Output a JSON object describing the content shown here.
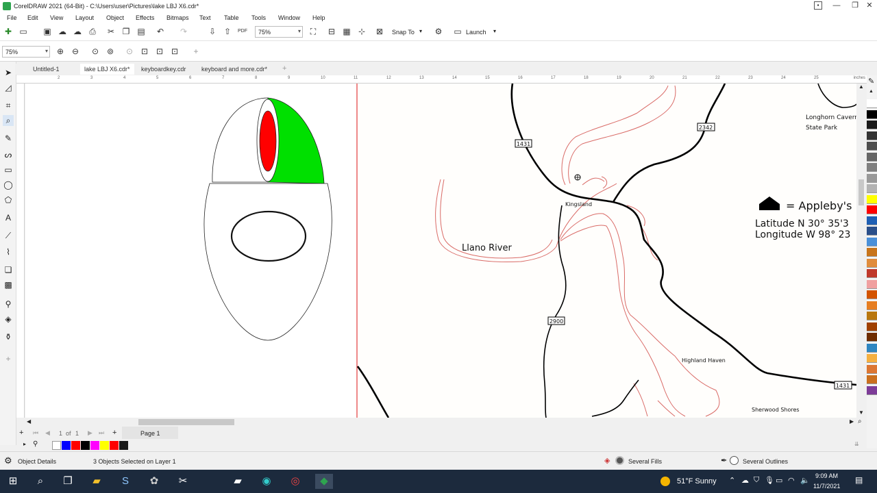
{
  "window": {
    "title": "CorelDRAW 2021 (64-Bit) - C:\\Users\\user\\Pictures\\lake LBJ X6.cdr*",
    "controls": [
      "minimize",
      "maximize",
      "close"
    ]
  },
  "menu": [
    "File",
    "Edit",
    "View",
    "Layout",
    "Object",
    "Effects",
    "Bitmaps",
    "Text",
    "Table",
    "Tools",
    "Window",
    "Help"
  ],
  "standard_toolbar": {
    "zoom_value": "75%",
    "snap_to_label": "Snap To",
    "launch_label": "Launch"
  },
  "property_bar": {
    "zoom_value": "75%"
  },
  "tabs": [
    {
      "label": "Untitled-1",
      "active": false
    },
    {
      "label": "lake LBJ X6.cdr*",
      "active": true
    },
    {
      "label": "keyboardkey.cdr",
      "active": false
    },
    {
      "label": "keyboard and more.cdr*",
      "active": false
    }
  ],
  "ruler": {
    "numbers": [
      "2",
      "3",
      "4",
      "5",
      "6",
      "7",
      "8",
      "9",
      "10",
      "11",
      "12",
      "13",
      "14",
      "15",
      "16",
      "17",
      "18",
      "19",
      "20",
      "21",
      "22",
      "23",
      "24",
      "25"
    ],
    "units": "inches"
  },
  "map": {
    "labels": {
      "river": "Llano River",
      "kingsland": "Kingsland",
      "highland_haven": "Highland Haven",
      "sherwood_shores": "Sherwood Shores",
      "longhorn_line1": "Longhorn Cavern",
      "longhorn_line2": "State Park",
      "applebys": "= Appleby's",
      "latitude": "Latitude N 30° 35'3",
      "longitude": "Longitude W 98° 23"
    },
    "shields": {
      "s1431a": "1431",
      "s2342": "2342",
      "s2900": "2900",
      "s1431b": "1431"
    }
  },
  "page_nav": {
    "current": "1",
    "of_label": "of",
    "total": "1",
    "page_tab": "Page 1"
  },
  "palette_colors": [
    "#0000ff",
    "#ff0000",
    "#000000",
    "#ff00ff",
    "#ffff00",
    "#ff0000",
    "#1a1a1a"
  ],
  "docker_colors": [
    "#ffffff",
    "#000000",
    "#1a1a1a",
    "#333333",
    "#4d4d4d",
    "#666666",
    "#808080",
    "#999999",
    "#b3b3b3",
    "#ffff00",
    "#ff0000",
    "#1e5fb4",
    "#2a4f8a",
    "#4a90d9",
    "#c8741a",
    "#e08c3c",
    "#c0392b",
    "#f0a0a0",
    "#d35400",
    "#e67e22",
    "#b9770e",
    "#a04000",
    "#6e2c00",
    "#2e86c1",
    "#f5b041",
    "#dc7633",
    "#ca6f1e",
    "#7d3c98"
  ],
  "status": {
    "object_details": "Object Details",
    "selection": "3 Objects Selected on Layer 1",
    "fills": "Several Fills",
    "outlines": "Several Outlines"
  },
  "taskbar": {
    "weather": "51°F  Sunny",
    "time": "9:09 AM",
    "date": "11/7/2021"
  }
}
